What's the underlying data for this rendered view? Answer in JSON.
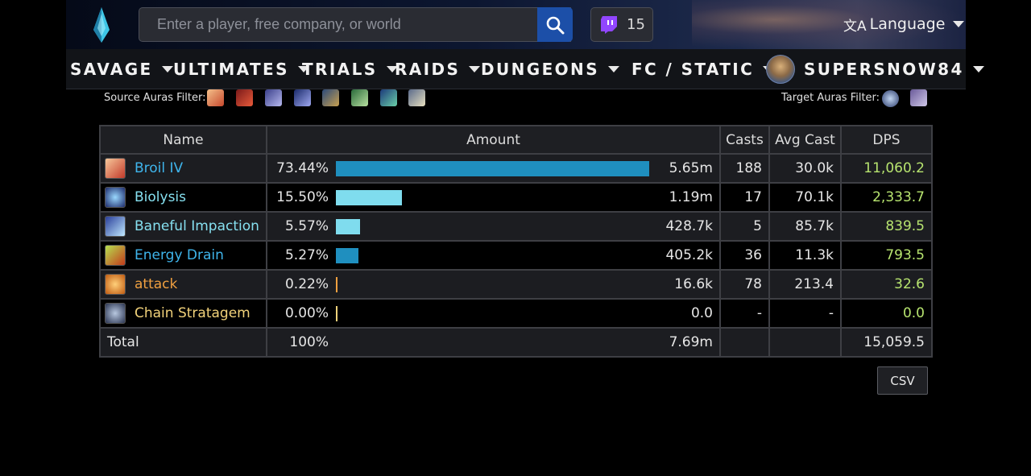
{
  "header": {
    "search_placeholder": "Enter a player, free company, or world",
    "twitch_count": "15",
    "language_label": "Language"
  },
  "nav": {
    "items": [
      {
        "label": "SAVAGE"
      },
      {
        "label": "ULTIMATES"
      },
      {
        "label": "TRIALS"
      },
      {
        "label": "RAIDS"
      },
      {
        "label": "DUNGEONS"
      },
      {
        "label": "FC / STATIC"
      }
    ],
    "user": "SUPERSNOW84"
  },
  "filters": {
    "source_label": "Source Auras Filter:",
    "target_label": "Target Auras Filter:"
  },
  "table": {
    "headers": {
      "name": "Name",
      "amount": "Amount",
      "casts": "Casts",
      "avg_cast": "Avg Cast",
      "dps": "DPS"
    },
    "rows": [
      {
        "name": "Broil IV",
        "name_color": "#3fb5ec",
        "percent": "73.44%",
        "fraction": 0.7344,
        "bar_color": "#1f8fbf",
        "amount": "5.65m",
        "casts": "188",
        "avg_cast": "30.0k",
        "dps": "11,060.2",
        "icon": "broil-icon"
      },
      {
        "name": "Biolysis",
        "name_color": "#86e0f0",
        "percent": "15.50%",
        "fraction": 0.155,
        "bar_color": "#7fdcee",
        "amount": "1.19m",
        "casts": "17",
        "avg_cast": "70.1k",
        "dps": "2,333.7",
        "icon": "biolysis-icon"
      },
      {
        "name": "Baneful Impaction",
        "name_color": "#86e0f0",
        "percent": "5.57%",
        "fraction": 0.0557,
        "bar_color": "#7fdcee",
        "amount": "428.7k",
        "casts": "5",
        "avg_cast": "85.7k",
        "dps": "839.5",
        "icon": "baneful-impaction-icon"
      },
      {
        "name": "Energy Drain",
        "name_color": "#3fb5ec",
        "percent": "5.27%",
        "fraction": 0.0527,
        "bar_color": "#1f8fbf",
        "amount": "405.2k",
        "casts": "36",
        "avg_cast": "11.3k",
        "dps": "793.5",
        "icon": "energy-drain-icon"
      },
      {
        "name": "attack",
        "name_color": "#f0a040",
        "percent": "0.22%",
        "fraction": 0.0022,
        "bar_color": "#f0a040",
        "amount": "16.6k",
        "casts": "78",
        "avg_cast": "213.4",
        "dps": "32.6",
        "icon": "attack-icon"
      },
      {
        "name": "Chain Stratagem",
        "name_color": "#f2d27a",
        "percent": "0.00%",
        "fraction": 0.0,
        "bar_color": "#f2d27a",
        "amount": "0.0",
        "casts": "-",
        "avg_cast": "-",
        "dps": "0.0",
        "icon": "chain-stratagem-icon"
      }
    ],
    "total": {
      "label": "Total",
      "percent": "100%",
      "amount": "7.69m",
      "dps": "15,059.5"
    }
  },
  "csv_label": "CSV"
}
